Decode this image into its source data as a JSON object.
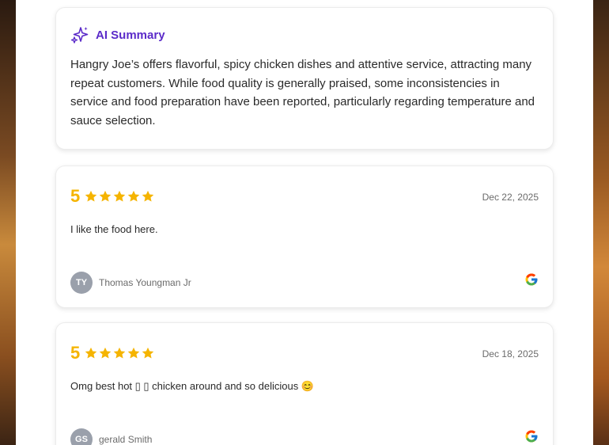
{
  "summary": {
    "title": "AI Summary",
    "icon": "sparkle-icon",
    "accent_color": "#5b2bc9",
    "text": "Hangry Joe’s offers flavorful, spicy chicken dishes and attentive service, attracting many repeat customers. While food quality is generally praised, some inconsistencies in service and food preparation have been reported, particularly regarding temperature and sauce selection."
  },
  "star_color": "#f5b400",
  "reviews": [
    {
      "rating": "5",
      "stars": 5,
      "date": "Dec 22, 2025",
      "text": "I like the food here.",
      "initials": "TY",
      "author": "Thomas Youngman Jr",
      "source_icon": "google-icon"
    },
    {
      "rating": "5",
      "stars": 5,
      "date": "Dec 18, 2025",
      "text": "Omg best hot ▯ ▯ chicken around and so delicious 😊",
      "initials": "GS",
      "author": "gerald Smith",
      "source_icon": "google-icon"
    }
  ]
}
